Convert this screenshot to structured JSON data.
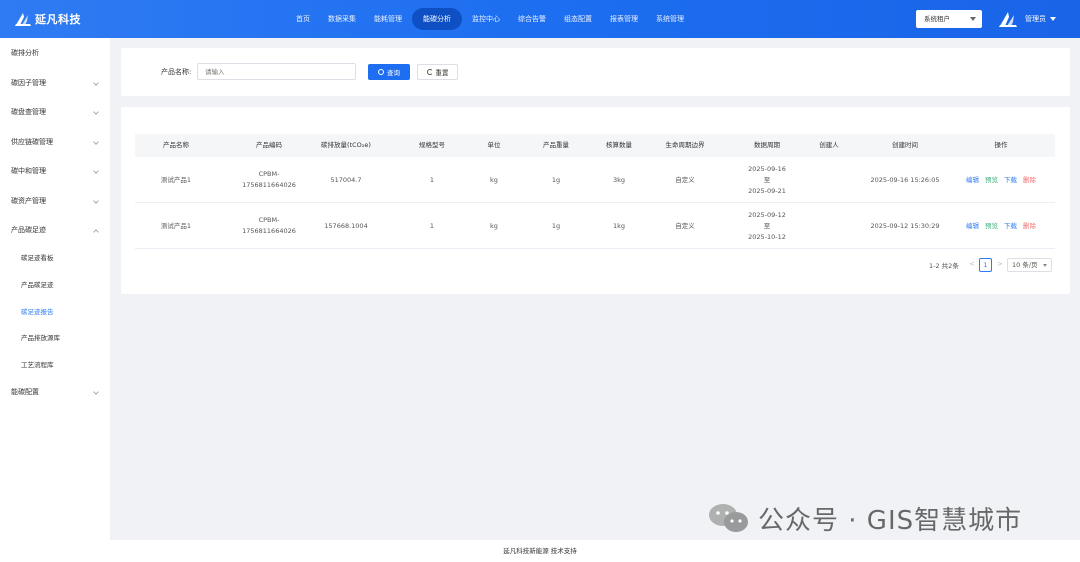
{
  "brand": {
    "name": "延凡科技",
    "header_color": "#1d6ef0",
    "accent": "#2f7bf3"
  },
  "nav": {
    "items": [
      {
        "label": "首页",
        "active": false
      },
      {
        "label": "数据采集",
        "active": false
      },
      {
        "label": "能耗管理",
        "active": false
      },
      {
        "label": "能碳分析",
        "active": true
      },
      {
        "label": "监控中心",
        "active": false
      },
      {
        "label": "综合告警",
        "active": false
      },
      {
        "label": "组态配置",
        "active": false
      },
      {
        "label": "报表管理",
        "active": false
      },
      {
        "label": "系统管理",
        "active": false
      }
    ]
  },
  "tenant": {
    "value": "系统租户"
  },
  "user": {
    "name": "管理员",
    "avatar_icon": "brand-logo-icon"
  },
  "sidebar": {
    "items": [
      {
        "label": "碳排分析"
      },
      {
        "label": "碳因子管理"
      },
      {
        "label": "碳盘查管理"
      },
      {
        "label": "供应链碳管理"
      },
      {
        "label": "碳中和管理"
      },
      {
        "label": "碳资产管理"
      },
      {
        "label": "产品碳足迹"
      },
      {
        "label": "能碳配置"
      }
    ],
    "subitems": [
      {
        "label": "碳足迹看板",
        "active": false
      },
      {
        "label": "产品碳足迹",
        "active": false
      },
      {
        "label": "碳足迹报告",
        "active": true
      },
      {
        "label": "产品排放源库",
        "active": false
      },
      {
        "label": "工艺流程库",
        "active": false
      }
    ]
  },
  "search": {
    "label": "产品名称:",
    "placeholder": "请输入",
    "query_label": "查询",
    "reset_label": "重置"
  },
  "table": {
    "columns": [
      "产品名称",
      "产品编码",
      "碳排放量(tCO₂e)",
      "规格型号",
      "单位",
      "产品重量",
      "核算数量",
      "生命周期边界",
      "数据周期",
      "创建人",
      "创建时间",
      "操作"
    ],
    "rows": [
      {
        "name": "测试产品1",
        "code_line1": "CPBM-",
        "code_line2": "1756811664026",
        "emission": "517004.7",
        "spec": "1",
        "unit": "kg",
        "weight": "1g",
        "qty": "3kg",
        "boundary": "自定义",
        "period_start": "2025-09-16",
        "period_sep": "至",
        "period_end": "2025-09-21",
        "creator": "",
        "created": "2025-09-16 15:26:05"
      },
      {
        "name": "测试产品1",
        "code_line1": "CPBM-",
        "code_line2": "1756811664026",
        "emission": "157668.1004",
        "spec": "1",
        "unit": "kg",
        "weight": "1g",
        "qty": "1kg",
        "boundary": "自定义",
        "period_start": "2025-09-12",
        "period_sep": "至",
        "period_end": "2025-10-12",
        "creator": "",
        "created": "2025-09-12 15:30:29"
      }
    ],
    "actions": {
      "edit": "编辑",
      "preview": "预览",
      "download": "下载",
      "delete": "删除"
    }
  },
  "pagination": {
    "total_text": "1-2 共2条",
    "current_page": "1",
    "page_size": "10 条/页",
    "prev": "<",
    "next": ">"
  },
  "footer": {
    "text": "延凡科技新能源 技术支持"
  },
  "watermark": {
    "text": "公众号 · GIS智慧城市"
  }
}
